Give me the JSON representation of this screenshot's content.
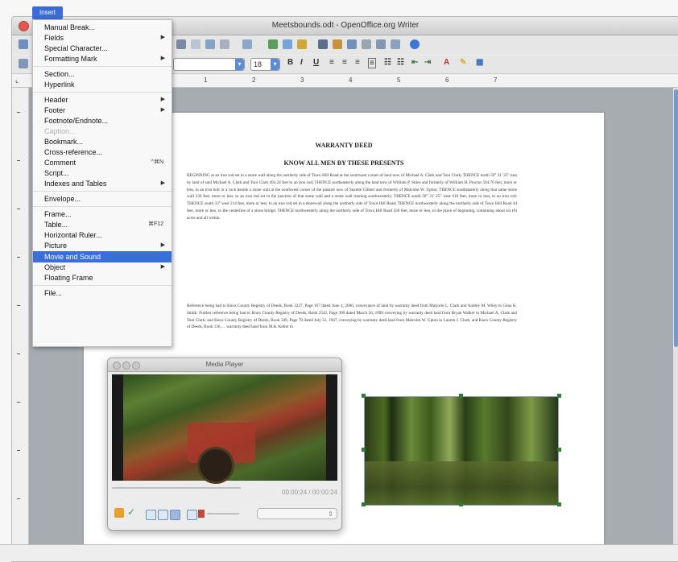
{
  "app": {
    "window_title": "Meetsbounds.odt - OpenOffice.org Writer"
  },
  "toolbar": {
    "font_size": "18"
  },
  "ruler": {
    "marks": [
      "1",
      "2",
      "3",
      "4",
      "5",
      "6",
      "7"
    ]
  },
  "insert_menu": {
    "title": "Insert",
    "highlighted": "Movie and Sound",
    "items": [
      {
        "label": "Manual Break...",
        "shortcut": "",
        "submenu": false,
        "disabled": false
      },
      {
        "label": "Fields",
        "shortcut": "",
        "submenu": true,
        "disabled": false
      },
      {
        "label": "Special Character...",
        "shortcut": "",
        "submenu": false,
        "disabled": false
      },
      {
        "label": "Formatting Mark",
        "shortcut": "",
        "submenu": true,
        "disabled": false
      },
      {
        "label": "Section...",
        "shortcut": "",
        "submenu": false,
        "disabled": false
      },
      {
        "label": "Hyperlink",
        "shortcut": "",
        "submenu": false,
        "disabled": false
      },
      {
        "label": "Header",
        "shortcut": "",
        "submenu": true,
        "disabled": false
      },
      {
        "label": "Footer",
        "shortcut": "",
        "submenu": true,
        "disabled": false
      },
      {
        "label": "Footnote/Endnote...",
        "shortcut": "",
        "submenu": false,
        "disabled": false
      },
      {
        "label": "Caption...",
        "shortcut": "",
        "submenu": false,
        "disabled": true
      },
      {
        "label": "Bookmark...",
        "shortcut": "",
        "submenu": false,
        "disabled": false
      },
      {
        "label": "Cross-reference...",
        "shortcut": "",
        "submenu": false,
        "disabled": false
      },
      {
        "label": "Comment",
        "shortcut": "^⌘N",
        "submenu": false,
        "disabled": false
      },
      {
        "label": "Script...",
        "shortcut": "",
        "submenu": false,
        "disabled": false
      },
      {
        "label": "Indexes and Tables",
        "shortcut": "",
        "submenu": true,
        "disabled": false
      },
      {
        "label": "Envelope...",
        "shortcut": "",
        "submenu": false,
        "disabled": false
      },
      {
        "label": "Frame...",
        "shortcut": "",
        "submenu": false,
        "disabled": false
      },
      {
        "label": "Table...",
        "shortcut": "⌘F12",
        "submenu": false,
        "disabled": false
      },
      {
        "label": "Horizontal Ruler...",
        "shortcut": "",
        "submenu": false,
        "disabled": false
      },
      {
        "label": "Picture",
        "shortcut": "",
        "submenu": true,
        "disabled": false
      },
      {
        "label": "Movie and Sound",
        "shortcut": "",
        "submenu": false,
        "disabled": false
      },
      {
        "label": "Object",
        "shortcut": "",
        "submenu": true,
        "disabled": false
      },
      {
        "label": "Floating Frame",
        "shortcut": "",
        "submenu": false,
        "disabled": false
      },
      {
        "label": "File...",
        "shortcut": "",
        "submenu": false,
        "disabled": false
      }
    ]
  },
  "document": {
    "title": "WARRANTY DEED",
    "subtitle": "KNOW ALL MEN BY THESE PRESENTS",
    "paragraph1": "BEGINNING at an iron rod set in a stone wall along the northerly side of Town Hill Road at the southwest corner of land now of Michael A. Clark and Toni Clark; THENCE north 59° 31' 25\" east by land of said Michael A. Clark and Toni Clark 492.24 feet to an iron rod; THENCE northeasterly along the land now of William P. Stiles and formerly of William H. Proctor 594.76 feet, more or less, to an iron bolt in a rock beside a stone wall at the southwest corner of the pasture now of Suzette Gilbert and formerly of Malcolm W. Upton; THENCE southeasterly along that same stone wall 230 feet, more or less, to an iron rod set in the junction of that stone wall and a stone wall running southwesterly; THENCE south 58° 31' 25\" west 610 feet, more or less, to an iron rod; THENCE south 33° west 214 feet, more or less, to an iron rod set in a stonewall along the northerly side of Town Hill Road; THENCE northwesterly along the northerly side of Town Hill Road 44 feet, more or less, to the centerline of a stone bridge; THENCE northwesterly along the northerly side of Town Hill Road 430 feet, more or less, to the place of beginning, containing about six (6) acres and all within.",
    "paragraph2": "Reference being had to Knox County Registry of Deeds, Book 3227, Page 167 dated June 4, 2006, conveyance of land by warranty deed from Marjorie L. Clark and Audrey M. Wiley to Gena K. Smith. Further reference being had to Knox County Registry of Deeds, Book 2542, Page 309 dated March 26, 1999 conveying by warranty deed land from Bryan Walker to Michael A. Clark and Toni Clark; and Knox County Registry of Deeds, Book 349, Page 70 dated July 31, 1947, conveying by warranty deed land from Malcolm W. Upton to Lauren J. Clark; and Knox County Registry of Deeds, Book 136, ... warranty deed land from M.R. Keller to"
  },
  "media_player": {
    "title": "Media Player",
    "time": "00:00:24 / 00:00:24"
  },
  "icons": {
    "player_apply": "checkmark-icon",
    "player_insert": "insert-media-icon"
  },
  "colors": {
    "menu_highlight": "#3b6fd8",
    "selection_handles": "#2d7f2d"
  }
}
